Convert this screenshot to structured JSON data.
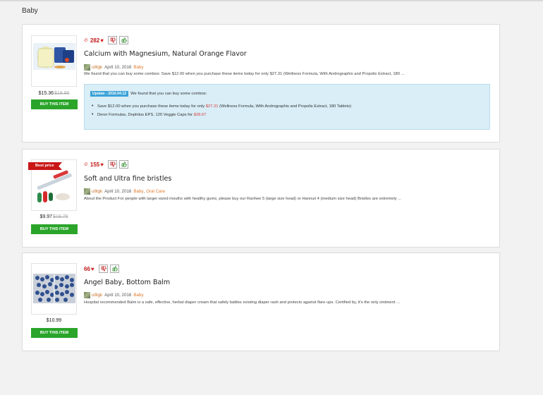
{
  "section_title": "Baby",
  "deals": [
    {
      "votes": "282",
      "title": "Calcium with Magnesium, Natural Orange Flavor",
      "user": "u8tgk",
      "date": "April 10, 2016",
      "categories": [
        "Baby"
      ],
      "description": "We found that you can buy some combos: Save $12.00 when you purchase these items today for only $27.31  (Wellness Formula, With Andrographis and Propolis Extract, 180 ...",
      "price": "$15.36",
      "old_price": "$18.86",
      "buy_label": "BUY THIS ITEM",
      "thumb_icon": "supplement-product-photo",
      "update": {
        "badge": "Update - 2016.04.12",
        "intro": "We found that you can buy some combos:",
        "items": [
          {
            "pre": "Save $12.00 when you purchase these items today for only ",
            "price": "$27.31",
            "post": "  (Wellness Formula, With Andrographis and Propolis Extract, 180 Tablets)"
          },
          {
            "pre": "Derer Formulas, Dophilus EPS, 120 Veggie Caps for ",
            "price": "$28.67",
            "post": ""
          }
        ]
      }
    },
    {
      "votes": "155",
      "title": "Soft and Ultra fine bristles",
      "user": "u8tgk",
      "date": "April 10, 2016",
      "categories": [
        "Baby",
        "Oral Care"
      ],
      "description": "About the Product For people with larger-sized mouths with healthy gums, please buy our Ranhee 5 (large size head) or Hannuii 4 (medium size head) Bristles are extremely ...",
      "price": "$9.97",
      "old_price": "$18.75",
      "buy_label": "BUY THIS ITEM",
      "ribbon": "Best price",
      "thumb_icon": "toothbrush-product-photo"
    },
    {
      "votes": "66",
      "title": "Angel Baby, Bottom Balm",
      "user": "u8tgk",
      "date": "April 10, 2016",
      "categories": [
        "Baby"
      ],
      "description": "Hospital recommended  Balm is a safe, effective, herbal diaper cream that safely battles existing diaper rash and protects against flare ups. Certified by, it's the only ointment ...",
      "price": "$10.99",
      "old_price": "",
      "buy_label": "BUY THIS ITEM",
      "thumb_icon": "blueberries-product-photo"
    }
  ],
  "colors": {
    "accent_red": "#c01818",
    "buy_green": "#2aa52a",
    "category_orange": "#e07a2b",
    "update_blue": "#3aa2d8"
  }
}
